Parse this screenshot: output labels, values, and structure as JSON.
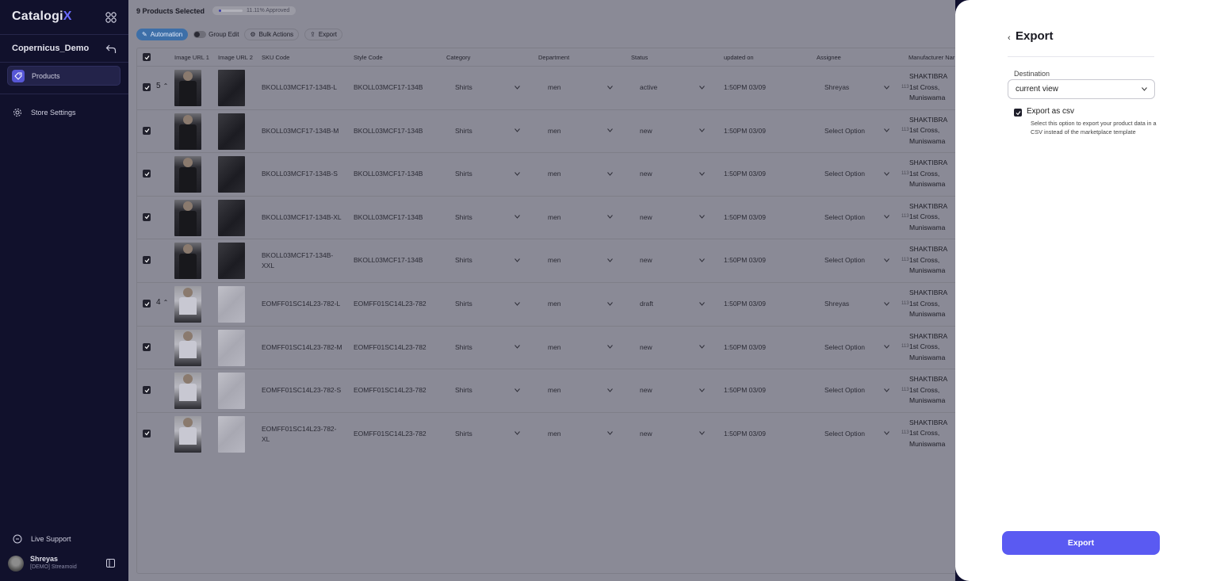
{
  "app": {
    "logo_main": "Catalogi",
    "logo_accent": "X"
  },
  "sidebar": {
    "workspace": "Copernicus_Demo",
    "items": [
      {
        "label": "Products",
        "icon": "tag-icon"
      },
      {
        "label": "Store Settings",
        "icon": "gear-icon"
      }
    ],
    "support": "Live Support",
    "user": {
      "name": "Shreyas",
      "org": "[DEMO] Streamoid"
    }
  },
  "topbar": {
    "selected": "9 Products Selected",
    "approved": "11.11% Approved",
    "approved_fraction": 0.1111
  },
  "toolbar": {
    "automation": "Automation",
    "group_edit": "Group Edit",
    "bulk_actions": "Bulk Actions",
    "export": "Export"
  },
  "table": {
    "headers": [
      "Image URL 1",
      "Image URL 2",
      "SKU Code",
      "Style Code",
      "Category",
      "Department",
      "Status",
      "updated on",
      "Assignee",
      "Manufacturer Nar"
    ],
    "rows": [
      {
        "group": "5",
        "sku": "BKOLL03MCF17-134B-L",
        "style": "BKOLL03MCF17-134B",
        "category": "Shirts",
        "department": "men",
        "status": "active",
        "updated": "1:50PM 03/09",
        "assignee": "Shreyas",
        "mfr1": "SHAKTIBRA",
        "mfr2": "1st Cross,",
        "mfr3": "Muniswama",
        "mfr_num": "113"
      },
      {
        "group": "",
        "sku": "BKOLL03MCF17-134B-M",
        "style": "BKOLL03MCF17-134B",
        "category": "Shirts",
        "department": "men",
        "status": "new",
        "updated": "1:50PM 03/09",
        "assignee": "Select Option",
        "mfr1": "SHAKTIBRA",
        "mfr2": "1st Cross,",
        "mfr3": "Muniswama",
        "mfr_num": "113"
      },
      {
        "group": "",
        "sku": "BKOLL03MCF17-134B-S",
        "style": "BKOLL03MCF17-134B",
        "category": "Shirts",
        "department": "men",
        "status": "new",
        "updated": "1:50PM 03/09",
        "assignee": "Select Option",
        "mfr1": "SHAKTIBRA",
        "mfr2": "1st Cross,",
        "mfr3": "Muniswama",
        "mfr_num": "113"
      },
      {
        "group": "",
        "sku": "BKOLL03MCF17-134B-XL",
        "style": "BKOLL03MCF17-134B",
        "category": "Shirts",
        "department": "men",
        "status": "new",
        "updated": "1:50PM 03/09",
        "assignee": "Select Option",
        "mfr1": "SHAKTIBRA",
        "mfr2": "1st Cross,",
        "mfr3": "Muniswama",
        "mfr_num": "113"
      },
      {
        "group": "",
        "sku": "BKOLL03MCF17-134B-XXL",
        "style": "BKOLL03MCF17-134B",
        "category": "Shirts",
        "department": "men",
        "status": "new",
        "updated": "1:50PM 03/09",
        "assignee": "Select Option",
        "mfr1": "SHAKTIBRA",
        "mfr2": "1st Cross,",
        "mfr3": "Muniswama",
        "mfr_num": "113"
      },
      {
        "group": "4",
        "sku": "EOMFF01SC14L23-782-L",
        "style": "EOMFF01SC14L23-782",
        "category": "Shirts",
        "department": "men",
        "status": "draft",
        "updated": "1:50PM 03/09",
        "assignee": "Shreyas",
        "mfr1": "SHAKTIBRA",
        "mfr2": "1st Cross,",
        "mfr3": "Muniswama",
        "mfr_num": "113"
      },
      {
        "group": "",
        "sku": "EOMFF01SC14L23-782-M",
        "style": "EOMFF01SC14L23-782",
        "category": "Shirts",
        "department": "men",
        "status": "new",
        "updated": "1:50PM 03/09",
        "assignee": "Select Option",
        "mfr1": "SHAKTIBRA",
        "mfr2": "1st Cross,",
        "mfr3": "Muniswama",
        "mfr_num": "113"
      },
      {
        "group": "",
        "sku": "EOMFF01SC14L23-782-S",
        "style": "EOMFF01SC14L23-782",
        "category": "Shirts",
        "department": "men",
        "status": "new",
        "updated": "1:50PM 03/09",
        "assignee": "Select Option",
        "mfr1": "SHAKTIBRA",
        "mfr2": "1st Cross,",
        "mfr3": "Muniswama",
        "mfr_num": "113"
      },
      {
        "group": "",
        "sku": "EOMFF01SC14L23-782-XL",
        "style": "EOMFF01SC14L23-782",
        "category": "Shirts",
        "department": "men",
        "status": "new",
        "updated": "1:50PM 03/09",
        "assignee": "Select Option",
        "mfr1": "SHAKTIBRA",
        "mfr2": "1st Cross,",
        "mfr3": "Muniswama",
        "mfr_num": "113"
      }
    ]
  },
  "export_panel": {
    "title": "Export",
    "destination_label": "Destination",
    "destination_value": "current view",
    "csv_label": "Export as csv",
    "csv_desc": "Select this option to export your product data in a CSV instead of the marketplace template",
    "button": "Export"
  },
  "colors": {
    "accent": "#5a5af2",
    "sidebar_bg": "#11112c"
  }
}
